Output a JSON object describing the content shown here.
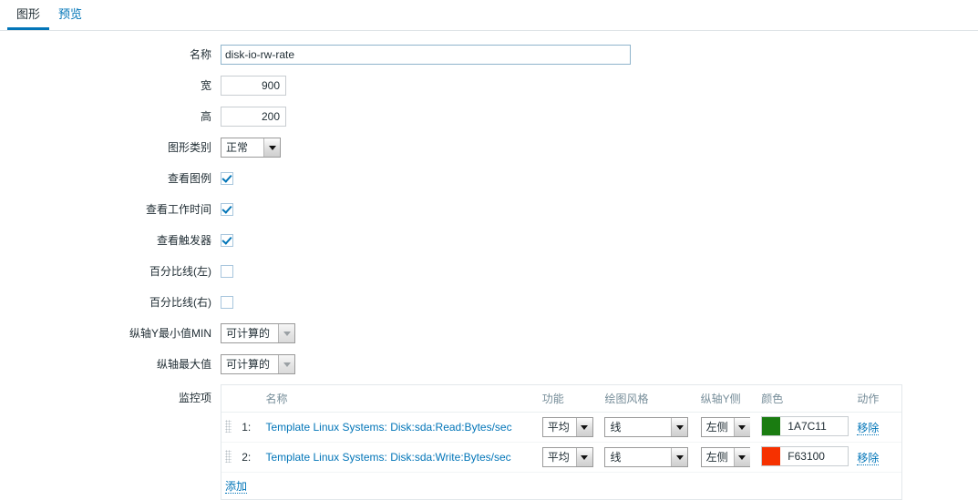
{
  "tabs": [
    {
      "label": "图形",
      "active": true
    },
    {
      "label": "预览",
      "active": false
    }
  ],
  "form": {
    "name": {
      "label": "名称",
      "value": "disk-io-rw-rate"
    },
    "width": {
      "label": "宽",
      "value": "900"
    },
    "height": {
      "label": "高",
      "value": "200"
    },
    "graph_type": {
      "label": "图形类别",
      "value": "正常"
    },
    "show_legend": {
      "label": "查看图例",
      "checked": true
    },
    "show_working_time": {
      "label": "查看工作时间",
      "checked": true
    },
    "show_triggers": {
      "label": "查看触发器",
      "checked": true
    },
    "percentile_left": {
      "label": "百分比线(左)",
      "checked": false
    },
    "percentile_right": {
      "label": "百分比线(右)",
      "checked": false
    },
    "y_min": {
      "label": "纵轴Y最小值MIN",
      "value": "可计算的"
    },
    "y_max": {
      "label": "纵轴最大值",
      "value": "可计算的"
    },
    "items": {
      "label": "监控项"
    }
  },
  "items_table": {
    "headers": {
      "name": "名称",
      "function": "功能",
      "draw_style": "绘图风格",
      "y_side": "纵轴Y侧",
      "color": "颜色",
      "action": "动作"
    },
    "rows": [
      {
        "num": "1:",
        "name": "Template Linux Systems: Disk:sda:Read:Bytes/sec",
        "function": "平均",
        "draw_style": "线",
        "y_side": "左侧",
        "color_value": "1A7C11",
        "color_hex": "#1A7C11",
        "action": "移除"
      },
      {
        "num": "2:",
        "name": "Template Linux Systems: Disk:sda:Write:Bytes/sec",
        "function": "平均",
        "draw_style": "线",
        "y_side": "左侧",
        "color_value": "F63100",
        "color_hex": "#F63100",
        "action": "移除"
      }
    ],
    "add_label": "添加"
  },
  "colors": {
    "accent": "#0275b8",
    "text": "#1f2c33",
    "muted": "#768d99"
  }
}
